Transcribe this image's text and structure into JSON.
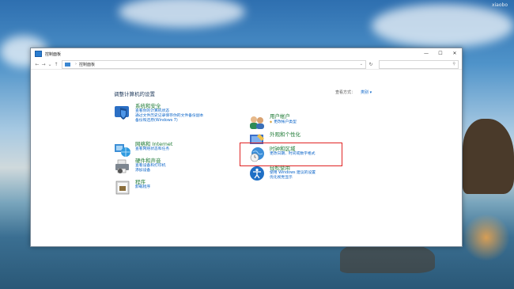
{
  "watermark": "xiaobo",
  "window": {
    "title": "控制面板",
    "controls": {
      "minimize": "—",
      "maximize": "☐",
      "close": "✕"
    }
  },
  "nav": {
    "back": "←",
    "forward": "→",
    "recent": "⌄",
    "up": "↑",
    "breadcrumb_sep": "›",
    "breadcrumb": "控制面板",
    "address_dropdown": "⌄",
    "refresh": "↻",
    "search_icon": "⚲"
  },
  "page": {
    "title": "调整计算机的设置",
    "view_by_label": "查看方式：",
    "view_by_value": "类别 ▾"
  },
  "categories_left": [
    {
      "icon": "shield-icon",
      "title": "系统和安全",
      "links": [
        "查看你的计算机状态",
        "通过文件历史记录保存你的文件备份副本",
        "备份和还原(Windows 7)"
      ]
    },
    {
      "icon": "network-icon",
      "title": "网络和 Internet",
      "links": [
        "查看网络状态和任务"
      ]
    },
    {
      "icon": "printer-icon",
      "title": "硬件和声音",
      "links": [
        "查看设备和打印机",
        "添加设备"
      ]
    },
    {
      "icon": "programs-icon",
      "title": "程序",
      "links": [
        "卸载程序"
      ]
    }
  ],
  "categories_right": [
    {
      "icon": "users-icon",
      "title": "用户帐户",
      "links": [
        "更改帐户类型"
      ]
    },
    {
      "icon": "appearance-icon",
      "title": "外观和个性化",
      "links": []
    },
    {
      "icon": "clock-globe-icon",
      "title": "时钟和区域",
      "links": [
        "更改日期、时间或数字格式"
      ]
    },
    {
      "icon": "ease-of-access-icon",
      "title": "轻松使用",
      "links": [
        "使用 Windows 建议的设置",
        "优化视觉显示"
      ]
    }
  ],
  "colors": {
    "category_title": "#1e7a35",
    "link": "#0a64c8",
    "highlight": "#e02424"
  }
}
